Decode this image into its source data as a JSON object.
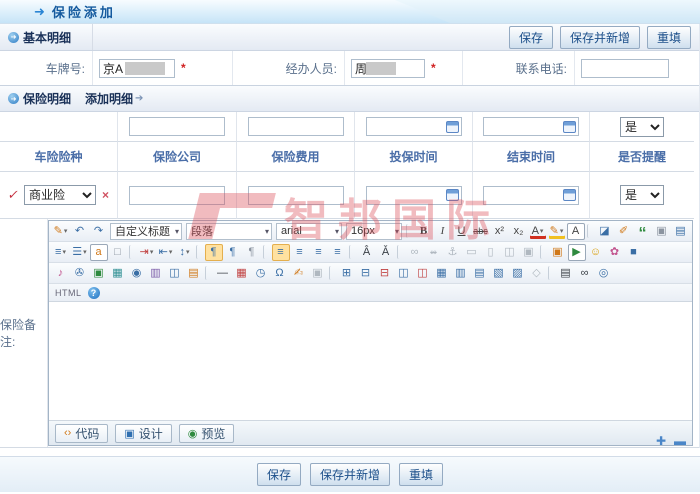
{
  "banner": {
    "title": "保险添加",
    "arrow_glyph": "➜"
  },
  "actions": {
    "save": "保存",
    "save_and_new": "保存并新增",
    "reset": "重填"
  },
  "sections": {
    "basic_title": "基本明细",
    "insurance_title": "保险明细",
    "add_detail_link": "添加明细",
    "bullet_glyph": "➜",
    "link_arrow_glyph": "➔"
  },
  "basic_form": {
    "plate_label": "车牌号:",
    "plate_value": "京A",
    "handler_label": "经办人员:",
    "handler_value": "周",
    "phone_label": "联系电话:",
    "phone_value": "",
    "required_mark": "*"
  },
  "insurance_table": {
    "headers": [
      "车险险种",
      "保险公司",
      "保险费用",
      "投保时间",
      "结束时间",
      "是否提醒"
    ],
    "template_row": {
      "remind_value": "是"
    },
    "detail_row": {
      "check_glyph": "✓",
      "type_value": "商业险",
      "delete_glyph": "×",
      "remind_value": "是"
    }
  },
  "remark_label": "保险备注:",
  "editor": {
    "row1_start": [
      {
        "n": "styles-icon",
        "g": "✎",
        "c": "c-orange drop"
      },
      {
        "n": "undo-icon",
        "g": "↶",
        "c": "c-blue"
      },
      {
        "n": "redo-icon",
        "g": "↷",
        "c": "c-blue"
      }
    ],
    "style_select": "自定义标题",
    "paragraph_select": "段落",
    "font_select": "arial",
    "size_select": "16px",
    "select_arrow": "▾",
    "row1_end": [
      {
        "n": "separator",
        "g": "",
        "c": "sep"
      },
      {
        "n": "bold-icon",
        "g": "B",
        "c": "ic-bold"
      },
      {
        "n": "italic-icon",
        "g": "I",
        "c": "ic-italic"
      },
      {
        "n": "underline-icon",
        "g": "U",
        "c": "ic-under"
      },
      {
        "n": "strikethrough-icon",
        "g": "abc",
        "c": "ic-strike"
      },
      {
        "n": "superscript-icon",
        "g": "x²",
        "c": ""
      },
      {
        "n": "subscript-icon",
        "g": "x₂",
        "c": ""
      },
      {
        "n": "font-color-icon",
        "g": "A",
        "c": "bar-red drop"
      },
      {
        "n": "highlight-color-icon",
        "g": "✎",
        "c": "bar-yellow drop c-orange"
      },
      {
        "n": "character-style-icon",
        "g": "A",
        "c": "boxed"
      },
      {
        "n": "separator",
        "g": "",
        "c": "sep"
      },
      {
        "n": "eraser-icon",
        "g": "◪",
        "c": "c-blue"
      },
      {
        "n": "format-painter-icon",
        "g": "✐",
        "c": "c-orange"
      },
      {
        "n": "blockquote-icon",
        "g": "“",
        "c": "ic-quote"
      },
      {
        "n": "paste-icon",
        "g": "▣",
        "c": "c-gray"
      },
      {
        "n": "fullscreen-icon",
        "g": "▤",
        "c": "c-blue"
      }
    ],
    "row2": [
      {
        "n": "ordered-list-icon",
        "g": "≡",
        "c": "c-blue drop"
      },
      {
        "n": "unordered-list-icon",
        "g": "☰",
        "c": "c-blue drop"
      },
      {
        "n": "lowercase-icon",
        "g": "a",
        "c": "boxed c-orange"
      },
      {
        "n": "new-page-icon",
        "g": "□",
        "c": "c-gray"
      },
      {
        "n": "separator",
        "g": "",
        "c": "sep"
      },
      {
        "n": "indent-icon",
        "g": "⇥",
        "c": "c-red drop"
      },
      {
        "n": "outdent-icon",
        "g": "⇤",
        "c": "c-blue drop"
      },
      {
        "n": "line-spacing-icon",
        "g": "↕",
        "c": "c-blue drop"
      },
      {
        "n": "separator",
        "g": "",
        "c": "sep"
      },
      {
        "n": "ltr-paragraph-icon",
        "g": "¶",
        "c": "act c-blue"
      },
      {
        "n": "rtl-paragraph-icon",
        "g": "¶",
        "c": "c-blue"
      },
      {
        "n": "paragraph-icon",
        "g": "¶",
        "c": "c-gray"
      },
      {
        "n": "separator",
        "g": "",
        "c": "sep"
      },
      {
        "n": "align-left-icon",
        "g": "≡",
        "c": "act c-blue"
      },
      {
        "n": "align-center-icon",
        "g": "≡",
        "c": "c-blue"
      },
      {
        "n": "align-right-icon",
        "g": "≡",
        "c": "c-blue"
      },
      {
        "n": "align-justify-icon",
        "g": "≡",
        "c": "c-blue"
      },
      {
        "n": "separator",
        "g": "",
        "c": "sep"
      },
      {
        "n": "ruby-above-icon",
        "g": "Â",
        "c": "c-dark"
      },
      {
        "n": "ruby-inline-icon",
        "g": "Ǎ",
        "c": "c-dark"
      },
      {
        "n": "separator",
        "g": "",
        "c": "sep"
      },
      {
        "n": "link-icon",
        "g": "∞",
        "c": "dis"
      },
      {
        "n": "unlink-icon",
        "g": "∞",
        "c": "dis ic-strike"
      },
      {
        "n": "anchor-icon",
        "g": "⚓",
        "c": "dis"
      },
      {
        "n": "textarea-icon",
        "g": "▭",
        "c": "dis"
      },
      {
        "n": "frame-icon",
        "g": "▯",
        "c": "dis"
      },
      {
        "n": "split-frame-icon",
        "g": "◫",
        "c": "dis"
      },
      {
        "n": "layer-icon",
        "g": "▣",
        "c": "dis"
      },
      {
        "n": "separator",
        "g": "",
        "c": "sep"
      },
      {
        "n": "image-icon",
        "g": "▣",
        "c": "c-orange"
      },
      {
        "n": "flash-icon",
        "g": "▶",
        "c": "c-green boxed"
      },
      {
        "n": "emoticon-icon",
        "g": "☺",
        "c": "c-yellow"
      },
      {
        "n": "clipart-icon",
        "g": "✿",
        "c": "c-pink"
      },
      {
        "n": "code-block-icon",
        "g": "■",
        "c": "c-blue"
      }
    ],
    "row3": [
      {
        "n": "media-music-icon",
        "g": "♪",
        "c": "c-pink"
      },
      {
        "n": "attachment-icon",
        "g": "✇",
        "c": "c-blue"
      },
      {
        "n": "insert-image-icon",
        "g": "▣",
        "c": "c-green"
      },
      {
        "n": "image-gallery-icon",
        "g": "▦",
        "c": "c-teal"
      },
      {
        "n": "insert-disc-icon",
        "g": "◉",
        "c": "c-blue"
      },
      {
        "n": "insert-film-icon",
        "g": "▥",
        "c": "c-purple"
      },
      {
        "n": "media-window-icon",
        "g": "◫",
        "c": "c-blue"
      },
      {
        "n": "photo-icon",
        "g": "▤",
        "c": "c-orange"
      },
      {
        "n": "separator",
        "g": "",
        "c": "sep"
      },
      {
        "n": "horizontal-rule-icon",
        "g": "—",
        "c": "c-dark"
      },
      {
        "n": "insert-date-icon",
        "g": "▦",
        "c": "c-red"
      },
      {
        "n": "insert-time-icon",
        "g": "◷",
        "c": "c-blue"
      },
      {
        "n": "special-character-icon",
        "g": "Ω",
        "c": "c-blue"
      },
      {
        "n": "insert-signature-icon",
        "g": "✍",
        "c": "c-orange"
      },
      {
        "n": "paste-word-icon",
        "g": "▣",
        "c": "dis"
      },
      {
        "n": "separator",
        "g": "",
        "c": "sep"
      },
      {
        "n": "insert-table-icon",
        "g": "⊞",
        "c": "c-blue"
      },
      {
        "n": "insert-row-icon",
        "g": "⊟",
        "c": "c-blue"
      },
      {
        "n": "delete-row-icon",
        "g": "⊟",
        "c": "c-red"
      },
      {
        "n": "insert-column-icon",
        "g": "◫",
        "c": "c-blue"
      },
      {
        "n": "delete-column-icon",
        "g": "◫",
        "c": "c-red"
      },
      {
        "n": "merge-cells-icon",
        "g": "▦",
        "c": "c-blue"
      },
      {
        "n": "split-cells-icon",
        "g": "▥",
        "c": "c-blue"
      },
      {
        "n": "merge-right-icon",
        "g": "▤",
        "c": "c-blue"
      },
      {
        "n": "merge-down-icon",
        "g": "▧",
        "c": "c-blue"
      },
      {
        "n": "cell-properties-icon",
        "g": "▨",
        "c": "c-blue"
      },
      {
        "n": "delete-table-icon",
        "g": "◇",
        "c": "dis"
      },
      {
        "n": "separator",
        "g": "",
        "c": "sep"
      },
      {
        "n": "print-icon",
        "g": "▤",
        "c": "c-dark"
      },
      {
        "n": "find-icon",
        "g": "∞",
        "c": "c-dark"
      },
      {
        "n": "zoom-preview-icon",
        "g": "◎",
        "c": "c-blue"
      }
    ],
    "html_tab": "HTML",
    "help_glyph": "?",
    "mode_tabs": [
      {
        "name": "code-tab",
        "glyph": "‹›",
        "label": "代码"
      },
      {
        "name": "design-tab",
        "glyph": "▣",
        "label": "设计"
      },
      {
        "name": "preview-tab",
        "glyph": "◉",
        "label": "预览"
      }
    ],
    "resize_icons": [
      {
        "name": "expand-editor-icon",
        "glyph": "✚"
      },
      {
        "name": "collapse-editor-icon",
        "glyph": "▬"
      }
    ]
  },
  "watermark": {
    "text": "智邦国际"
  },
  "colors": {
    "accent_blue": "#155a9e",
    "header_text": "#4a6ea8",
    "watermark_red": "#dd4f5a",
    "required_red": "#d02020"
  }
}
